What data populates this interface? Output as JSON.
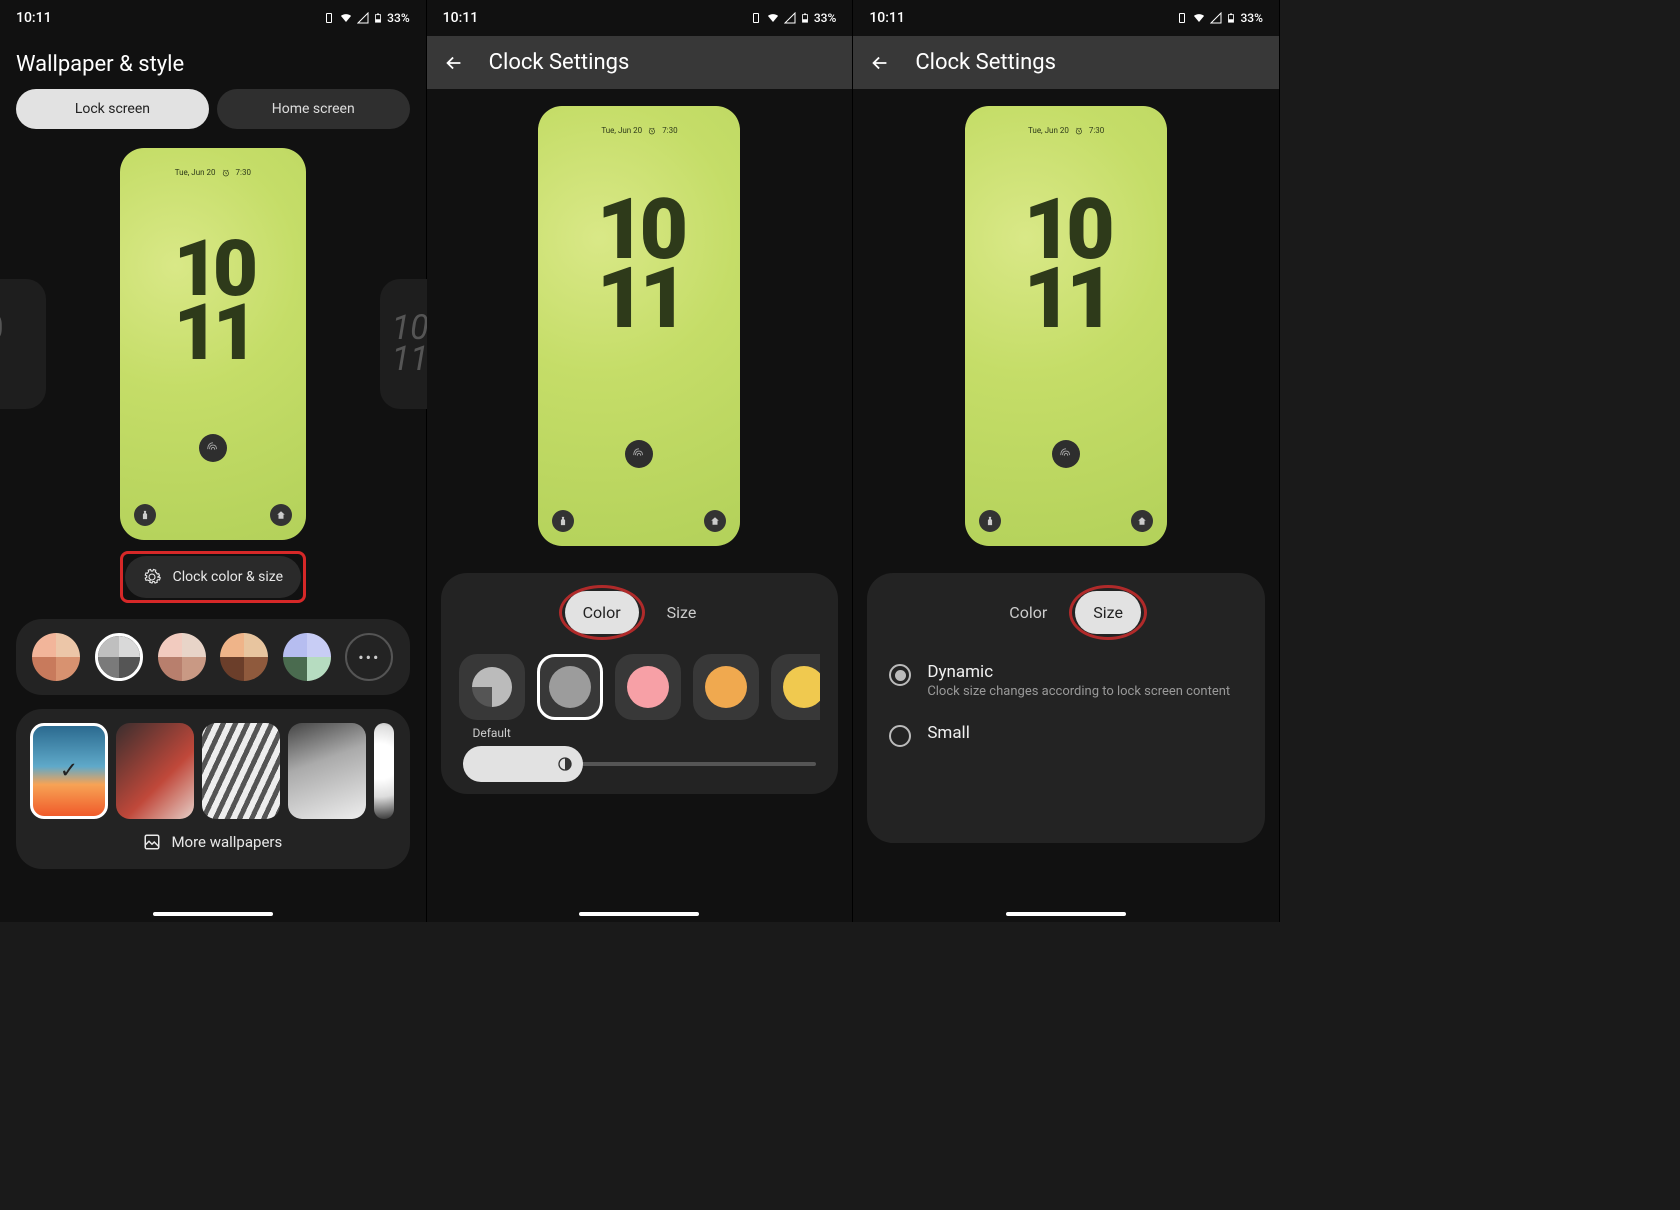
{
  "status": {
    "time": "10:11",
    "battery": "33%"
  },
  "screen1": {
    "title": "Wallpaper & style",
    "tabs": {
      "lock": "Lock screen",
      "home": "Home screen"
    },
    "preview": {
      "date": "Tue, Jun 20",
      "alarm": "7:30",
      "clock_top": "10",
      "clock_bottom": "11"
    },
    "side_clock": {
      "top": "10",
      "bottom": "11"
    },
    "clock_settings_btn": "Clock color & size",
    "swatch_more": "•••",
    "more_wallpapers": "More wallpapers"
  },
  "screen2": {
    "title": "Clock Settings",
    "preview": {
      "date": "Tue, Jun 20",
      "alarm": "7:30",
      "clock_top": "10",
      "clock_bottom": "11"
    },
    "tabs": {
      "color": "Color",
      "size": "Size"
    },
    "default_label": "Default",
    "colors": {
      "grey": "#9c9c9c",
      "pink": "#f7a0a6",
      "orange": "#f0a94f"
    }
  },
  "screen3": {
    "title": "Clock Settings",
    "preview": {
      "date": "Tue, Jun 20",
      "alarm": "7:30",
      "clock_top": "10",
      "clock_bottom": "11"
    },
    "tabs": {
      "color": "Color",
      "size": "Size"
    },
    "options": {
      "dynamic": {
        "title": "Dynamic",
        "sub": "Clock size changes according to lock screen content"
      },
      "small": {
        "title": "Small"
      }
    }
  }
}
